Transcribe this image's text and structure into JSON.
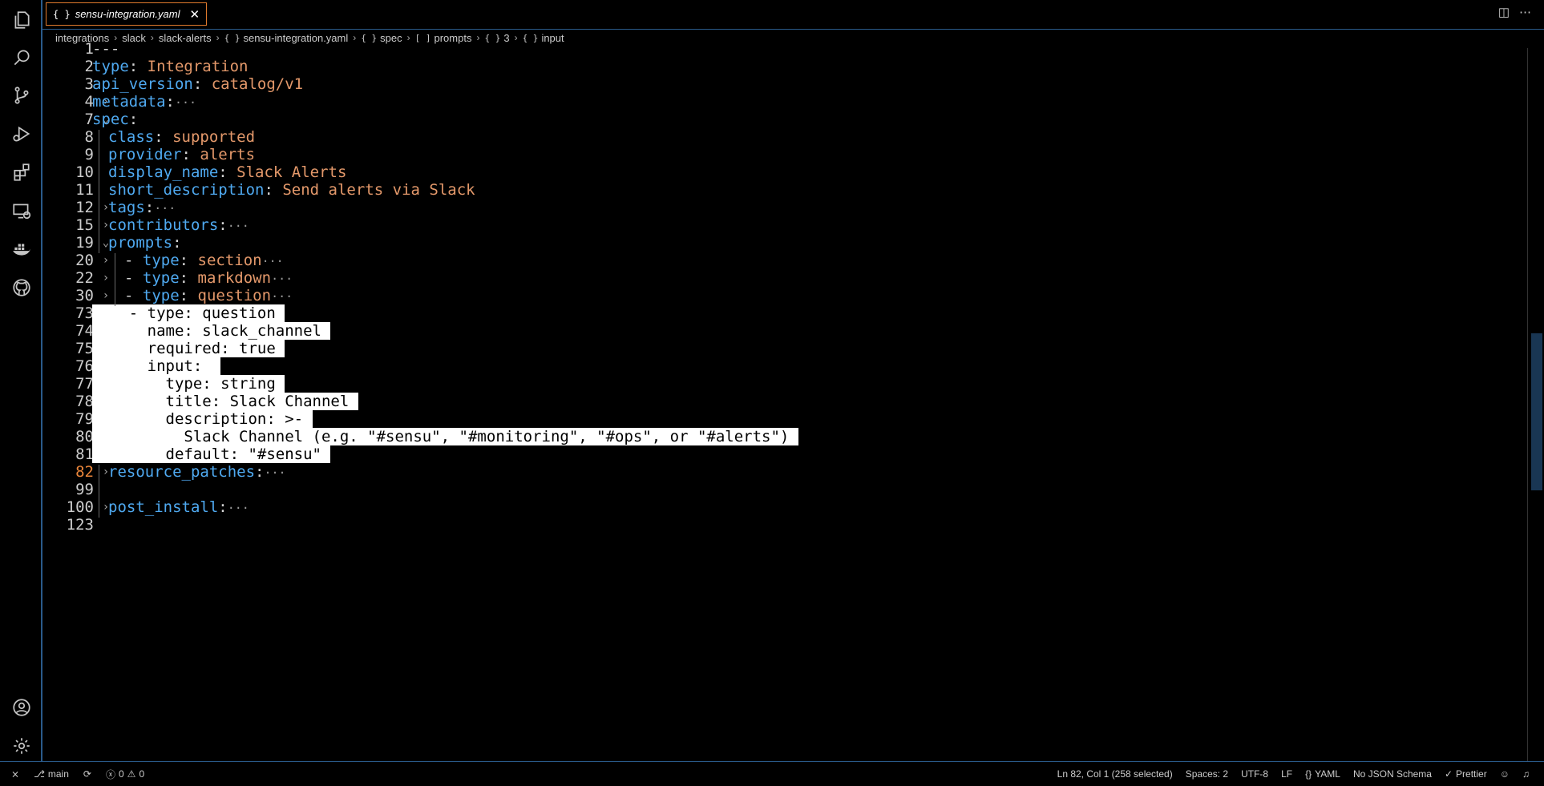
{
  "tab": {
    "icon": "{ }",
    "title": "sensu-integration.yaml",
    "close": "✕"
  },
  "tab_actions": {
    "split": "◫",
    "more": "⋯"
  },
  "breadcrumb": [
    {
      "icon": "",
      "label": "integrations"
    },
    {
      "icon": "",
      "label": "slack"
    },
    {
      "icon": "",
      "label": "slack-alerts"
    },
    {
      "icon": "{ }",
      "label": "sensu-integration.yaml"
    },
    {
      "icon": "{ }",
      "label": "spec"
    },
    {
      "icon": "[ ]",
      "label": "prompts"
    },
    {
      "icon": "{ }",
      "label": "3"
    },
    {
      "icon": "{ }",
      "label": "input"
    }
  ],
  "activity_icons": [
    "files-icon",
    "search-icon",
    "source-control-icon",
    "run-debug-icon",
    "extensions-icon",
    "remote-explorer-icon",
    "docker-icon",
    "github-icon"
  ],
  "activity_bottom_icons": [
    "account-icon",
    "settings-gear-icon"
  ],
  "lines": [
    {
      "n": "1",
      "fold": "",
      "indent": 0,
      "parts": [
        {
          "t": "---",
          "c": "p"
        }
      ]
    },
    {
      "n": "2",
      "fold": "",
      "indent": 0,
      "parts": [
        {
          "t": "type",
          "c": "k"
        },
        {
          "t": ": ",
          "c": "p"
        },
        {
          "t": "Integration",
          "c": "v"
        }
      ]
    },
    {
      "n": "3",
      "fold": "",
      "indent": 0,
      "parts": [
        {
          "t": "api_version",
          "c": "k"
        },
        {
          "t": ": ",
          "c": "p"
        },
        {
          "t": "catalog/v1",
          "c": "v"
        }
      ]
    },
    {
      "n": "4",
      "fold": "›",
      "indent": 0,
      "parts": [
        {
          "t": "metadata",
          "c": "k"
        },
        {
          "t": ":",
          "c": "p"
        },
        {
          "t": "···",
          "c": "dots"
        }
      ]
    },
    {
      "n": "7",
      "fold": "⌄",
      "indent": 0,
      "parts": [
        {
          "t": "spec",
          "c": "k"
        },
        {
          "t": ":",
          "c": "p"
        }
      ]
    },
    {
      "n": "8",
      "fold": "",
      "indent": 1,
      "parts": [
        {
          "t": "class",
          "c": "k"
        },
        {
          "t": ": ",
          "c": "p"
        },
        {
          "t": "supported",
          "c": "v"
        }
      ]
    },
    {
      "n": "9",
      "fold": "",
      "indent": 1,
      "parts": [
        {
          "t": "provider",
          "c": "k"
        },
        {
          "t": ": ",
          "c": "p"
        },
        {
          "t": "alerts",
          "c": "v"
        }
      ]
    },
    {
      "n": "10",
      "fold": "",
      "indent": 1,
      "parts": [
        {
          "t": "display_name",
          "c": "k"
        },
        {
          "t": ": ",
          "c": "p"
        },
        {
          "t": "Slack Alerts",
          "c": "v"
        }
      ]
    },
    {
      "n": "11",
      "fold": "",
      "indent": 1,
      "parts": [
        {
          "t": "short_description",
          "c": "k"
        },
        {
          "t": ": ",
          "c": "p"
        },
        {
          "t": "Send alerts via Slack",
          "c": "v"
        }
      ]
    },
    {
      "n": "12",
      "fold": "›",
      "indent": 1,
      "parts": [
        {
          "t": "tags",
          "c": "k"
        },
        {
          "t": ":",
          "c": "p"
        },
        {
          "t": "···",
          "c": "dots"
        }
      ]
    },
    {
      "n": "15",
      "fold": "›",
      "indent": 1,
      "parts": [
        {
          "t": "contributors",
          "c": "k"
        },
        {
          "t": ":",
          "c": "p"
        },
        {
          "t": "···",
          "c": "dots"
        }
      ]
    },
    {
      "n": "19",
      "fold": "⌄",
      "indent": 1,
      "parts": [
        {
          "t": "prompts",
          "c": "k"
        },
        {
          "t": ":",
          "c": "p"
        }
      ]
    },
    {
      "n": "20",
      "fold": "›",
      "indent": 2,
      "parts": [
        {
          "t": "- ",
          "c": "p"
        },
        {
          "t": "type",
          "c": "k"
        },
        {
          "t": ": ",
          "c": "p"
        },
        {
          "t": "section",
          "c": "v"
        },
        {
          "t": "···",
          "c": "dots"
        }
      ]
    },
    {
      "n": "22",
      "fold": "›",
      "indent": 2,
      "parts": [
        {
          "t": "- ",
          "c": "p"
        },
        {
          "t": "type",
          "c": "k"
        },
        {
          "t": ": ",
          "c": "p"
        },
        {
          "t": "markdown",
          "c": "v"
        },
        {
          "t": "···",
          "c": "dots"
        }
      ]
    },
    {
      "n": "30",
      "fold": "›",
      "indent": 2,
      "parts": [
        {
          "t": "- ",
          "c": "p"
        },
        {
          "t": "type",
          "c": "k"
        },
        {
          "t": ": ",
          "c": "p"
        },
        {
          "t": "question",
          "c": "v"
        },
        {
          "t": "···",
          "c": "dots"
        }
      ]
    },
    {
      "n": "73",
      "fold": "⌄",
      "indent": 0,
      "sel": true,
      "parts": [
        {
          "t": "    - type: question ",
          "c": "sel"
        }
      ]
    },
    {
      "n": "74",
      "fold": "",
      "indent": 0,
      "sel": true,
      "parts": [
        {
          "t": "      name: slack_channel ",
          "c": "sel"
        }
      ]
    },
    {
      "n": "75",
      "fold": "",
      "indent": 0,
      "sel": true,
      "parts": [
        {
          "t": "      required: true ",
          "c": "sel"
        }
      ]
    },
    {
      "n": "76",
      "fold": "⌄",
      "indent": 0,
      "sel": true,
      "parts": [
        {
          "t": "      input:  ",
          "c": "sel"
        }
      ]
    },
    {
      "n": "77",
      "fold": "",
      "indent": 0,
      "sel": true,
      "parts": [
        {
          "t": "        type: string ",
          "c": "sel"
        }
      ]
    },
    {
      "n": "78",
      "fold": "",
      "indent": 0,
      "sel": true,
      "parts": [
        {
          "t": "        title: Slack Channel ",
          "c": "sel"
        }
      ]
    },
    {
      "n": "79",
      "fold": "⌄",
      "indent": 0,
      "sel": true,
      "parts": [
        {
          "t": "        description: >- ",
          "c": "sel"
        }
      ]
    },
    {
      "n": "80",
      "fold": "",
      "indent": 0,
      "sel": true,
      "parts": [
        {
          "t": "          Slack Channel (e.g. \"#sensu\", \"#monitoring\", \"#ops\", or \"#alerts\") ",
          "c": "sel"
        }
      ]
    },
    {
      "n": "81",
      "fold": "",
      "indent": 0,
      "sel": true,
      "parts": [
        {
          "t": "        default: \"#sensu\" ",
          "c": "sel"
        }
      ]
    },
    {
      "n": "82",
      "fold": "›",
      "indent": 1,
      "cur": true,
      "parts": [
        {
          "t": "resource_patches",
          "c": "k"
        },
        {
          "t": ":",
          "c": "p"
        },
        {
          "t": "···",
          "c": "dots"
        }
      ]
    },
    {
      "n": "99",
      "fold": "",
      "indent": 1,
      "parts": []
    },
    {
      "n": "100",
      "fold": "›",
      "indent": 1,
      "parts": [
        {
          "t": "post_install",
          "c": "k"
        },
        {
          "t": ":",
          "c": "p"
        },
        {
          "t": "···",
          "c": "dots"
        }
      ]
    },
    {
      "n": "123",
      "fold": "",
      "indent": 0,
      "parts": []
    }
  ],
  "status": {
    "remote": "⨯",
    "branch": "main",
    "sync": "⟳",
    "errors": "0",
    "warnings": "0",
    "position": "Ln 82, Col 1 (258 selected)",
    "spaces": "Spaces: 2",
    "encoding": "UTF-8",
    "eol": "LF",
    "language": "YAML",
    "schema": "No JSON Schema",
    "formatter": "Prettier"
  }
}
